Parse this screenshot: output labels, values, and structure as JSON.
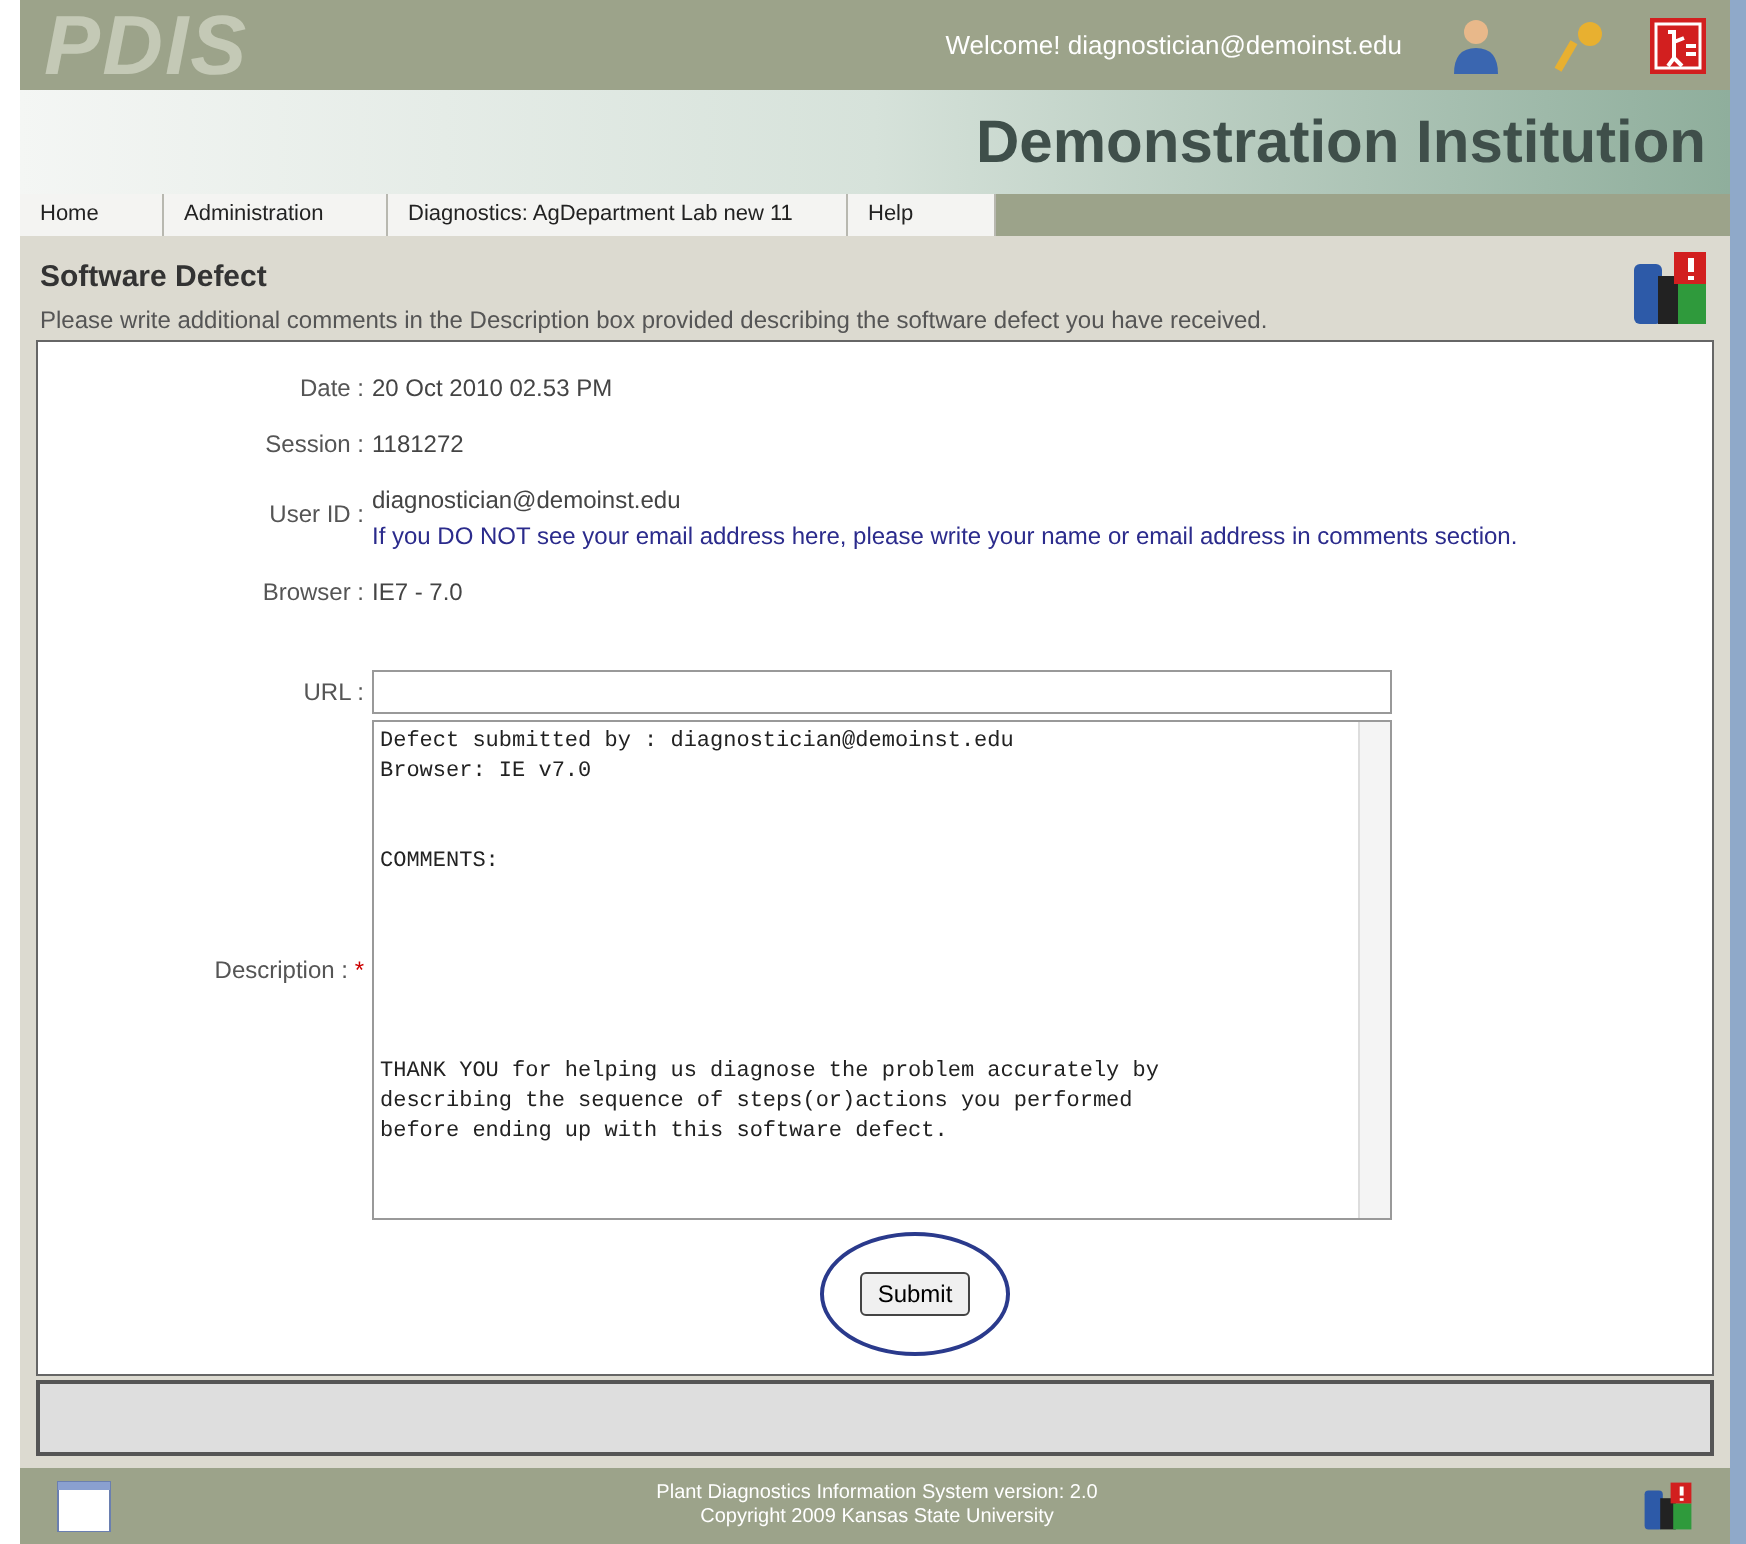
{
  "header": {
    "logo": "PDIS",
    "welcome": "Welcome! diagnostician@demoinst.edu"
  },
  "banner": {
    "title": "Demonstration Institution"
  },
  "nav": [
    {
      "label": "Home"
    },
    {
      "label": "Administration"
    },
    {
      "label": "Diagnostics: AgDepartment Lab new 11"
    },
    {
      "label": "Help"
    }
  ],
  "page": {
    "title": "Software Defect",
    "subtitle": "Please write additional comments in the Description box provided describing the software defect you have received."
  },
  "info": [
    {
      "label": "Date :",
      "value": "20 Oct 2010 02.53 PM"
    },
    {
      "label": "Session :",
      "value": "1181272"
    },
    {
      "label": "User ID :",
      "value": "diagnostician@demoinst.edu",
      "note": "If you DO NOT see your email address here, please write your name or email address in comments section."
    },
    {
      "label": "Browser :",
      "value": "IE7 -  7.0"
    }
  ],
  "url": {
    "label": "URL :"
  },
  "description": {
    "label": "Description :",
    "required_mark": "*",
    "value": "Defect submitted by : diagnostician@demoinst.edu\nBrowser: IE v7.0\n\n\nCOMMENTS:\n\n\n\n\n\n\nTHANK YOU for helping us diagnose the problem accurately by\ndescribing the sequence of steps(or)actions you performed\nbefore ending up with this software defect."
  },
  "submit": {
    "label": "Submit",
    "highlighted": true
  },
  "footer": {
    "lines": [
      "Plant Diagnostics Information System version: 2.0",
      "Copyright 2009 Kansas State University"
    ]
  }
}
